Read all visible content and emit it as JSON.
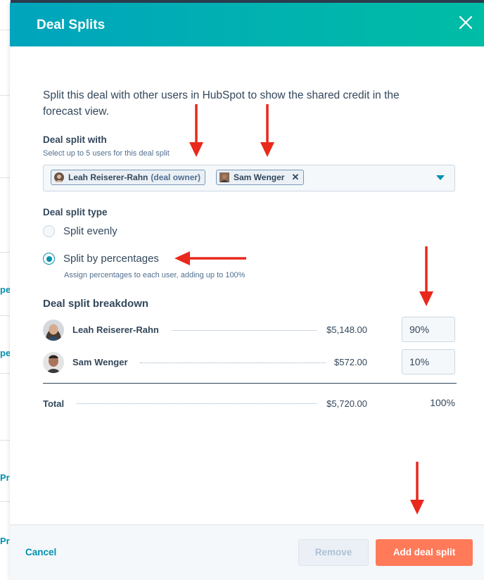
{
  "modal": {
    "title": "Deal Splits",
    "intro": "Split this deal with other users in HubSpot to show the shared credit in the forecast view."
  },
  "split_with": {
    "label": "Deal split with",
    "helper": "Select up to 5 users for this deal split",
    "chips": [
      {
        "name": "Leah Reiserer-Rahn",
        "tag": "(deal owner)"
      },
      {
        "name": "Sam Wenger",
        "remove": "✕"
      }
    ]
  },
  "split_type": {
    "label": "Deal split type",
    "options": [
      {
        "label": "Split evenly",
        "checked": false
      },
      {
        "label": "Split by percentages",
        "checked": true,
        "helper": "Assign percentages to each user, adding up to 100%"
      }
    ]
  },
  "breakdown": {
    "title": "Deal split breakdown",
    "rows": [
      {
        "name": "Leah Reiserer-Rahn",
        "amount": "$5,148.00",
        "percent": "90%"
      },
      {
        "name": "Sam Wenger",
        "amount": "$572.00",
        "percent": "10%"
      }
    ],
    "total": {
      "label": "Total",
      "amount": "$5,720.00",
      "percent": "100%"
    }
  },
  "footer": {
    "cancel": "Cancel",
    "remove": "Remove",
    "add": "Add deal split"
  },
  "background": {
    "fragments": [
      "per",
      "per",
      "Pr",
      "Pr"
    ]
  },
  "colors": {
    "header_start": "#00a4bd",
    "header_end": "#00bda5",
    "accent": "#0091ae",
    "primary_button": "#ff7a59",
    "annotation_arrow": "#e8291c"
  }
}
